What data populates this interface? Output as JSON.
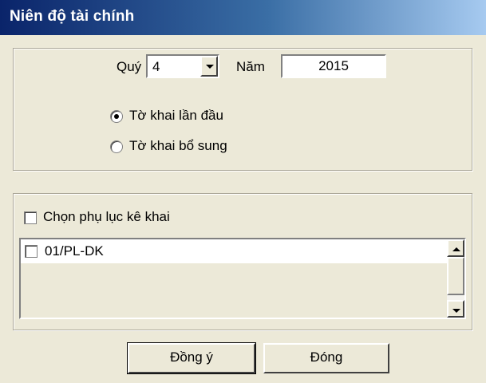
{
  "window": {
    "title": "Niên độ tài chính"
  },
  "period": {
    "quarter_label": "Quý",
    "quarter_value": "4",
    "year_label": "Năm",
    "year_value": "2015"
  },
  "declaration_type": {
    "options": [
      {
        "label": "Tờ khai lần đầu",
        "selected": true
      },
      {
        "label": "Tờ khai bổ sung",
        "selected": false
      }
    ]
  },
  "appendix": {
    "select_label": "Chọn phụ lục kê khai",
    "select_checked": false,
    "items": [
      {
        "label": "01/PL-DK",
        "checked": false
      }
    ]
  },
  "buttons": {
    "ok_label": "Đồng ý",
    "close_label": "Đóng"
  },
  "colors": {
    "window_bg": "#ECE9D8",
    "title_gradient_start": "#0A246A",
    "title_gradient_end": "#A6CAF0"
  }
}
